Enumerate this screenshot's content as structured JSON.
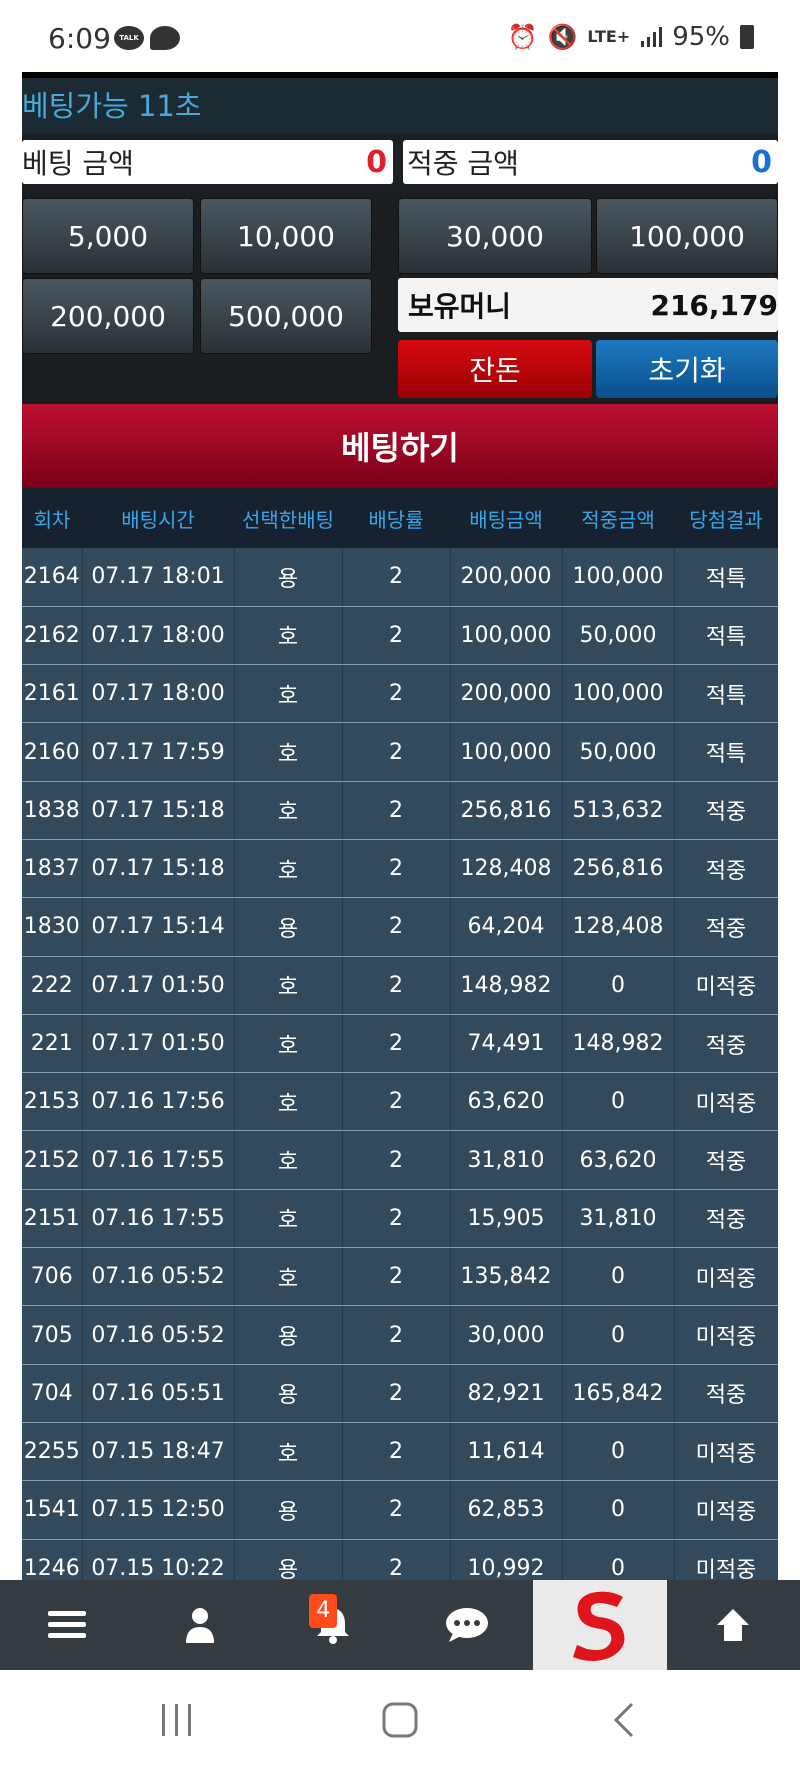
{
  "status_bar": {
    "time": "6:09",
    "talk_badge": "TALK",
    "network": "LTE+",
    "battery": "95%"
  },
  "betting": {
    "timer_text": "베팅가능 11초",
    "bet_amount_label": "베팅 금액",
    "bet_amount_value": "0",
    "win_amount_label": "적중 금액",
    "win_amount_value": "0",
    "chips": [
      "5,000",
      "10,000",
      "30,000",
      "100,000",
      "200,000",
      "500,000"
    ],
    "money_label": "보유머니",
    "money_value": "216,179",
    "balance_button": "잔돈",
    "reset_button": "초기화",
    "bet_button": "베팅하기"
  },
  "history": {
    "columns": [
      "회차",
      "배팅시간",
      "선택한배팅",
      "배당률",
      "배팅금액",
      "적중금액",
      "당첨결과"
    ],
    "rows": [
      {
        "round": "2164",
        "time": "07.17 18:01",
        "pick": "용",
        "odds": "2",
        "bet": "200,000",
        "win": "100,000",
        "result": "적특",
        "type": "special"
      },
      {
        "round": "2162",
        "time": "07.17 18:00",
        "pick": "호",
        "odds": "2",
        "bet": "100,000",
        "win": "50,000",
        "result": "적특",
        "type": "special"
      },
      {
        "round": "2161",
        "time": "07.17 18:00",
        "pick": "호",
        "odds": "2",
        "bet": "200,000",
        "win": "100,000",
        "result": "적특",
        "type": "special"
      },
      {
        "round": "2160",
        "time": "07.17 17:59",
        "pick": "호",
        "odds": "2",
        "bet": "100,000",
        "win": "50,000",
        "result": "적특",
        "type": "special"
      },
      {
        "round": "1838",
        "time": "07.17 15:18",
        "pick": "호",
        "odds": "2",
        "bet": "256,816",
        "win": "513,632",
        "result": "적중",
        "type": "hit"
      },
      {
        "round": "1837",
        "time": "07.17 15:18",
        "pick": "호",
        "odds": "2",
        "bet": "128,408",
        "win": "256,816",
        "result": "적중",
        "type": "hit"
      },
      {
        "round": "1830",
        "time": "07.17 15:14",
        "pick": "용",
        "odds": "2",
        "bet": "64,204",
        "win": "128,408",
        "result": "적중",
        "type": "hit"
      },
      {
        "round": "222",
        "time": "07.17 01:50",
        "pick": "호",
        "odds": "2",
        "bet": "148,982",
        "win": "0",
        "result": "미적중",
        "type": "miss"
      },
      {
        "round": "221",
        "time": "07.17 01:50",
        "pick": "호",
        "odds": "2",
        "bet": "74,491",
        "win": "148,982",
        "result": "적중",
        "type": "hit"
      },
      {
        "round": "2153",
        "time": "07.16 17:56",
        "pick": "호",
        "odds": "2",
        "bet": "63,620",
        "win": "0",
        "result": "미적중",
        "type": "miss"
      },
      {
        "round": "2152",
        "time": "07.16 17:55",
        "pick": "호",
        "odds": "2",
        "bet": "31,810",
        "win": "63,620",
        "result": "적중",
        "type": "hit"
      },
      {
        "round": "2151",
        "time": "07.16 17:55",
        "pick": "호",
        "odds": "2",
        "bet": "15,905",
        "win": "31,810",
        "result": "적중",
        "type": "hit"
      },
      {
        "round": "706",
        "time": "07.16 05:52",
        "pick": "호",
        "odds": "2",
        "bet": "135,842",
        "win": "0",
        "result": "미적중",
        "type": "miss"
      },
      {
        "round": "705",
        "time": "07.16 05:52",
        "pick": "용",
        "odds": "2",
        "bet": "30,000",
        "win": "0",
        "result": "미적중",
        "type": "miss"
      },
      {
        "round": "704",
        "time": "07.16 05:51",
        "pick": "용",
        "odds": "2",
        "bet": "82,921",
        "win": "165,842",
        "result": "적중",
        "type": "hit"
      },
      {
        "round": "2255",
        "time": "07.15 18:47",
        "pick": "호",
        "odds": "2",
        "bet": "11,614",
        "win": "0",
        "result": "미적중",
        "type": "miss"
      },
      {
        "round": "1541",
        "time": "07.15 12:50",
        "pick": "용",
        "odds": "2",
        "bet": "62,853",
        "win": "0",
        "result": "미적중",
        "type": "miss"
      },
      {
        "round": "1246",
        "time": "07.15 10:22",
        "pick": "용",
        "odds": "2",
        "bet": "10,992",
        "win": "0",
        "result": "미적중",
        "type": "miss"
      }
    ]
  },
  "bottom_nav": {
    "notification_count": "4",
    "icons": [
      "menu-icon",
      "user-icon",
      "bell-icon",
      "chat-icon",
      "logo",
      "arrow-up-icon"
    ]
  },
  "colors": {
    "special": "#f5a623",
    "hit": "#148a2c",
    "miss": "#d8142a",
    "header_text": "#38a6e8"
  }
}
